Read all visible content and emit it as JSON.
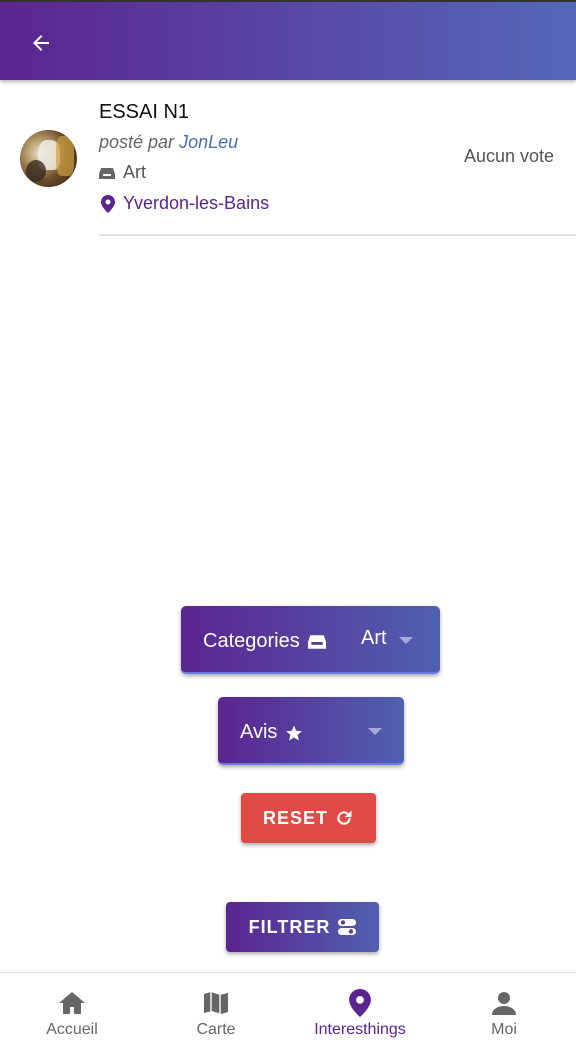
{
  "header": {
    "back_icon": "arrow-left-icon"
  },
  "post": {
    "title": "ESSAI N1",
    "posted_prefix": "posté par ",
    "author": "JonLeu",
    "category": "Art",
    "location": "Yverdon-les-Bains",
    "votes": "Aucun vote"
  },
  "filters": {
    "categories_label": "Categories",
    "categories_value": "Art",
    "avis_label": "Avis",
    "reset_label": "RESET",
    "filter_label": "FILTRER"
  },
  "nav": {
    "items": [
      {
        "label": "Accueil",
        "icon": "home-icon"
      },
      {
        "label": "Carte",
        "icon": "map-icon"
      },
      {
        "label": "Interesthings",
        "icon": "map-pin-icon"
      },
      {
        "label": "Moi",
        "icon": "person-icon"
      }
    ],
    "active": "Interesthings"
  },
  "colors": {
    "primary": "#5b2590",
    "accent": "#5568b8",
    "reset": "#e24b45"
  }
}
